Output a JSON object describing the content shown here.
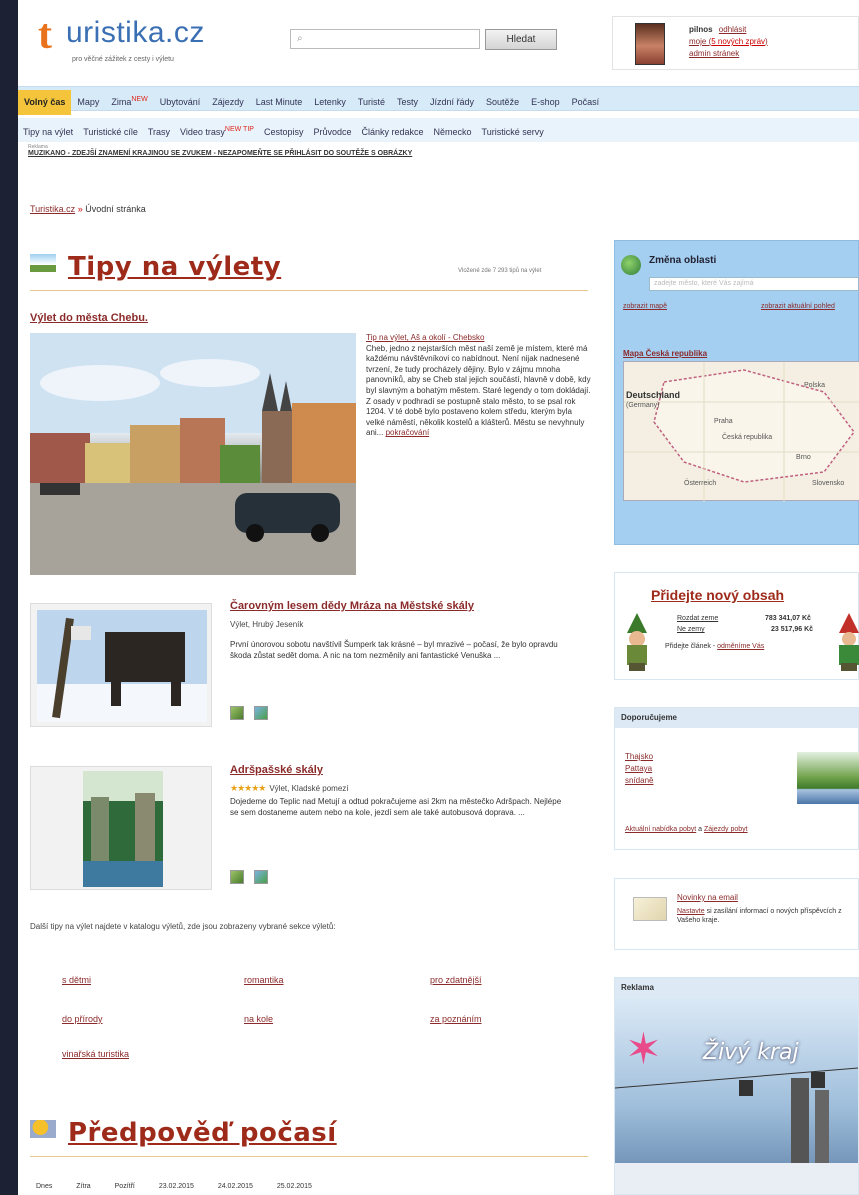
{
  "header": {
    "logo_t": "t",
    "logo_word": "uristika.cz",
    "logo_sub": "pro věčné zážitek z cesty i výletu",
    "search_placeholder": "",
    "search_button": "Hledat",
    "user_name": "pilnos",
    "user_logout": "odhlásit",
    "user_msgs_prefix": "moje (",
    "user_msgs_new": "5 nových zpráv",
    "user_msgs_suffix": ")",
    "user_admin": "admin stránek"
  },
  "nav_main": [
    {
      "label": "Volný čas",
      "active": true
    },
    {
      "label": "Mapy"
    },
    {
      "label": "Zima",
      "badge": "NEW"
    },
    {
      "label": "Ubytování"
    },
    {
      "label": "Zájezdy"
    },
    {
      "label": "Last Minute"
    },
    {
      "label": "Letenky"
    },
    {
      "label": "Turisté"
    },
    {
      "label": "Testy"
    },
    {
      "label": "Jízdní řády"
    },
    {
      "label": "Soutěže"
    },
    {
      "label": "E-shop"
    },
    {
      "label": "Počasí"
    }
  ],
  "nav_sub": [
    {
      "label": "Tipy na výlet"
    },
    {
      "label": "Turistické cíle"
    },
    {
      "label": "Trasy"
    },
    {
      "label": "Video trasy",
      "badge": "NEW TIP"
    },
    {
      "label": "Cestopisy"
    },
    {
      "label": "Průvodce"
    },
    {
      "label": "Články redakce"
    },
    {
      "label": "Německo"
    },
    {
      "label": "Turistické servy"
    }
  ],
  "ticker": {
    "small": "Reklama",
    "text": "MUZIKANO - ZDEJŠÍ ZNAMENÍ KRAJINOU SE ZVUKEM - NEZAPOMEŇTE SE PŘIHLÁSIT DO SOUTĚŽE S OBRÁZKY"
  },
  "breadcrumb": {
    "root": "Turistika.cz",
    "sep": "»",
    "current": "Úvodní stránka"
  },
  "section_trips": {
    "title": "Tipy na výlety",
    "note": "Vložené zde 7 293 tipů na výlet"
  },
  "article1": {
    "title": "Výlet do města Chebu.",
    "lead": "Tip na výlet, Aš a okolí - Chebsko",
    "text": "Cheb, jedno z nejstarších měst naší země je místem, které má každému návštěvníkovi co nabídnout. Není nijak nadnesené tvrzení, že tudy procházely dějiny. Bylo v zájmu mnoha panovníků, aby se Cheb stal jejich součástí, hlavně v době, kdy byl slavným a bohatým městem. Staré legendy o tom dokládají. Z osady v podhradí se postupně stalo město, to se psal rok 1204. V té době bylo postaveno kolem středu, kterým byla velké náměstí, několik kostelů a klášterů. Městu se nevyhnuly ani...",
    "more": "pokračování"
  },
  "article2": {
    "title": "Čarovným lesem dědy Mráza na Městské skály",
    "meta": "Výlet, Hrubý Jeseník",
    "text": "První únorovou sobotu navštívil Šumperk tak krásné – byl mrazivé – počasí, že bylo opravdu škoda zůstat sedět doma. A nic na tom nezměnily ani fantastické Venuška ..."
  },
  "article3": {
    "title": "Adršpašské skály",
    "stars": "★★★★★",
    "meta": "Výlet, Kladské pomezí",
    "text": "Dojedeme do Teplic nad Metují a odtud pokračujeme asi 2km na městečko Adršpach. Nejlépe se sem dostaneme autem nebo na kole, jezdí sem ale také autobusová doprava. ..."
  },
  "more_text": "Další tipy na výlet najdete v katalogu výletů, zde jsou zobrazeny vybrané sekce výletů:",
  "categories": [
    "s dětmi",
    "romantika",
    "pro zdatnější",
    "do přírody",
    "na kole",
    "za poznáním",
    "vinařská turistika"
  ],
  "section_weather": {
    "title": "Předpověď počasí"
  },
  "weather_header": [
    "Dnes",
    "Zítra",
    "Pozítří",
    "23.02.2015",
    "24.02.2015",
    "25.02.2015"
  ],
  "sidebar": {
    "region_title": "Změna oblasti",
    "region_placeholder": "zadejte město, které Vás zajímá",
    "region_link1": "zobrazit mapě",
    "region_link2": "zobrazit aktuální pohled",
    "map_title": "Mapa Česká republika",
    "map_labels": [
      "Deutschland",
      "(Germany)",
      "Praha",
      "Česká republika",
      "Brno",
      "Polska",
      "Österreich",
      "Slovensko"
    ],
    "add_title": "Přidejte nový obsah",
    "add_rows": [
      {
        "label": "Rozdat zeme",
        "value": "783 341,07 Kč"
      },
      {
        "label": "Ne zemy",
        "value": "23 517,96 Kč"
      }
    ],
    "add_foot_prefix": "Přidejte článek - ",
    "add_foot_link": "odměníme Vás",
    "rec_title": "Doporučujeme",
    "rec_links": [
      "Thajsko",
      "Pattaya",
      "snídaně"
    ],
    "rec_foot_a": "Aktuální nabídka pobyt",
    "rec_foot_sep": " a ",
    "rec_foot_b": "Zájezdy pobyt",
    "news_link": "Novinky na email",
    "news_sub_link": "Nastavte",
    "news_text": " si zasílání informací o nových příspěvcích z Vašeho kraje.",
    "ad_title": "Reklama",
    "ad_text": "Živý kraj"
  }
}
